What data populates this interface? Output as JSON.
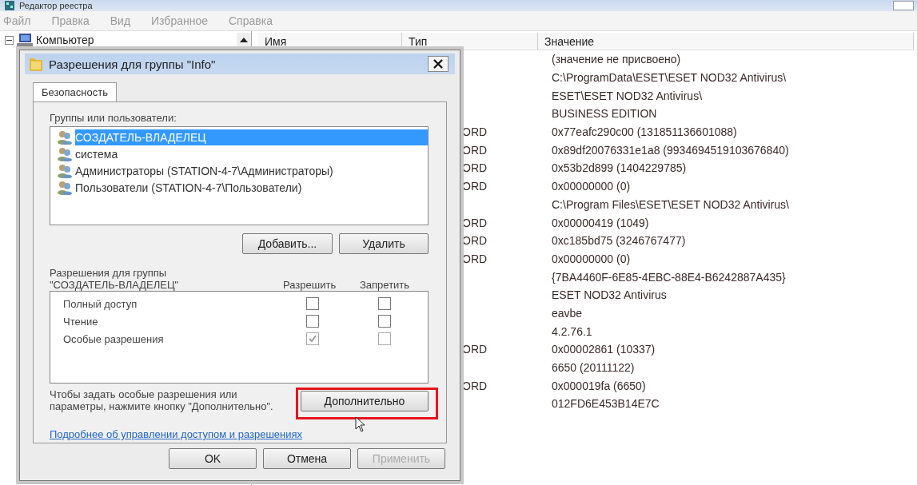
{
  "window": {
    "title": "Редактор реестра"
  },
  "menu": [
    "Файл",
    "Правка",
    "Вид",
    "Избранное",
    "Справка"
  ],
  "tree": {
    "items": [
      {
        "label": "Компьютер",
        "expanded": true
      }
    ]
  },
  "columns": [
    "Имя",
    "Тип",
    "Значение"
  ],
  "rows": [
    {
      "type": "",
      "value": "(значение не присвоено)"
    },
    {
      "type": "",
      "value": "C:\\ProgramData\\ESET\\ESET NOD32 Antivirus\\"
    },
    {
      "type": "",
      "value": "ESET\\ESET NOD32 Antivirus\\"
    },
    {
      "type": "",
      "value": "BUSINESS EDITION"
    },
    {
      "type": "ORD",
      "value": "0x77eafc290c00 (131851136601088)"
    },
    {
      "type": "ORD",
      "value": "0x89df20076331e1a8 (9934694519103676840)"
    },
    {
      "type": "ORD",
      "value": "0x53b2d899 (1404229785)"
    },
    {
      "type": "ORD",
      "value": "0x00000000 (0)"
    },
    {
      "type": "",
      "value": "C:\\Program Files\\ESET\\ESET NOD32 Antivirus\\"
    },
    {
      "type": "ORD",
      "value": "0x00000419 (1049)"
    },
    {
      "type": "ORD",
      "value": "0xc185bd75 (3246767477)"
    },
    {
      "type": "ORD",
      "value": "0x00000000 (0)"
    },
    {
      "type": "",
      "value": "{7BA4460F-6E85-4EBC-88E4-B6242887A435}"
    },
    {
      "type": "",
      "value": "ESET NOD32 Antivirus"
    },
    {
      "type": "",
      "value": "eavbe"
    },
    {
      "type": "",
      "value": "4.2.76.1"
    },
    {
      "type": "ORD",
      "value": "0x00002861 (10337)"
    },
    {
      "type": "",
      "value": "6650 (20111122)"
    },
    {
      "type": "ORD",
      "value": "0x000019fa (6650)"
    },
    {
      "type": "",
      "value": "012FD6E453B14E7C"
    }
  ],
  "dialog": {
    "title": "Разрешения для группы \"Info\"",
    "tabs": [
      {
        "label": "Безопасность",
        "selected": true
      }
    ],
    "groups_label": "Группы или пользователи:",
    "groups": [
      {
        "name": "СОЗДАТЕЛЬ-ВЛАДЕЛЕЦ",
        "selected": true
      },
      {
        "name": "система",
        "selected": false
      },
      {
        "name": "Администраторы (STATION-4-7\\Администраторы)",
        "selected": false
      },
      {
        "name": "Пользователи (STATION-4-7\\Пользователи)",
        "selected": false
      }
    ],
    "add_button": "Добавить...",
    "remove_button": "Удалить",
    "permissions_label": "Разрешения для группы\n\"СОЗДАТЕЛЬ-ВЛАДЕЛЕЦ\"",
    "allow_header": "Разрешить",
    "deny_header": "Запретить",
    "permissions": [
      {
        "name": "Полный доступ",
        "allow": {
          "checked": false,
          "disabled": false
        },
        "deny": {
          "checked": false,
          "disabled": false
        }
      },
      {
        "name": "Чтение",
        "allow": {
          "checked": false,
          "disabled": false
        },
        "deny": {
          "checked": false,
          "disabled": false
        }
      },
      {
        "name": "Особые разрешения",
        "allow": {
          "checked": true,
          "disabled": true
        },
        "deny": {
          "checked": false,
          "disabled": true
        }
      }
    ],
    "hint": "Чтобы задать особые разрешения или параметры, нажмите кнопку \"Дополнительно\".",
    "advanced_button": "Дополнительно",
    "link": "Подробнее об управлении доступом и разрешениях",
    "footer_buttons": [
      {
        "label": "OK",
        "disabled": false
      },
      {
        "label": "Отмена",
        "disabled": false
      },
      {
        "label": "Применить",
        "disabled": true
      }
    ]
  }
}
